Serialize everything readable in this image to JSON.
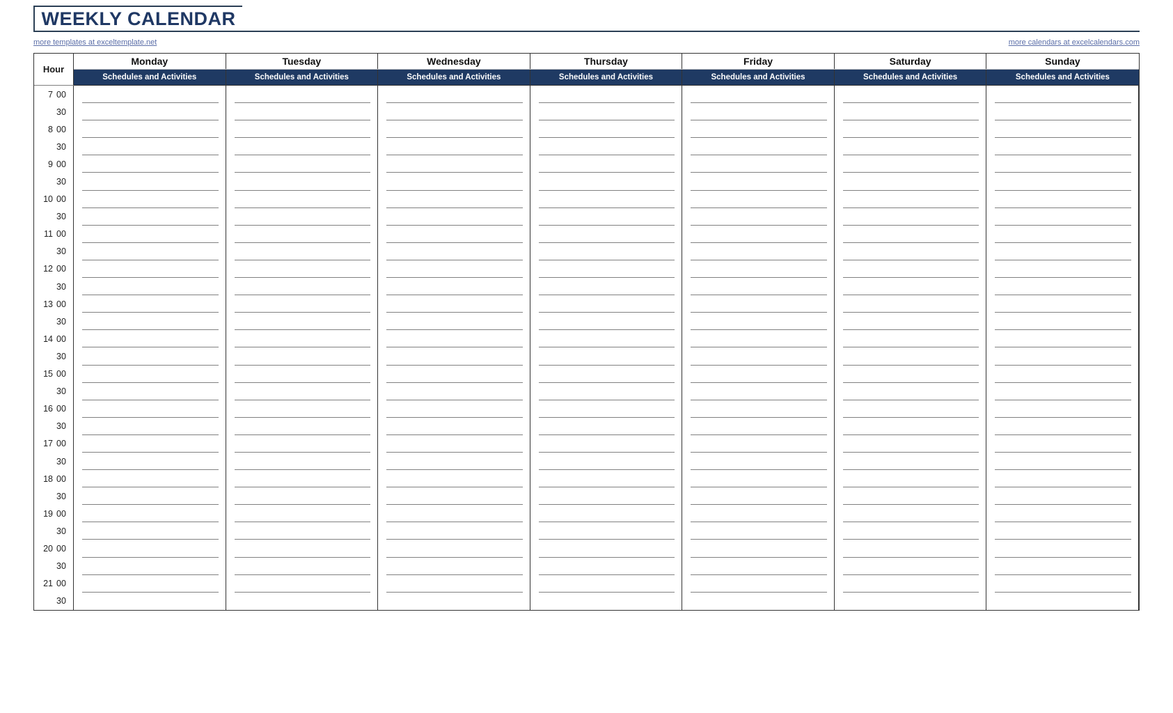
{
  "header": {
    "title": "WEEKLY CALENDAR",
    "left_link": "more templates at exceltemplate.net",
    "right_link": "more calendars at excelcalendars.com"
  },
  "table": {
    "hour_header": "Hour",
    "days": [
      {
        "name": "Monday",
        "sub": "Schedules and Activities"
      },
      {
        "name": "Tuesday",
        "sub": "Schedules and Activities"
      },
      {
        "name": "Wednesday",
        "sub": "Schedules and Activities"
      },
      {
        "name": "Thursday",
        "sub": "Schedules and Activities"
      },
      {
        "name": "Friday",
        "sub": "Schedules and Activities"
      },
      {
        "name": "Saturday",
        "sub": "Schedules and Activities"
      },
      {
        "name": "Sunday",
        "sub": "Schedules and Activities"
      }
    ],
    "rows": [
      {
        "hour": "7",
        "minute": "00"
      },
      {
        "hour": "",
        "minute": "30"
      },
      {
        "hour": "8",
        "minute": "00"
      },
      {
        "hour": "",
        "minute": "30"
      },
      {
        "hour": "9",
        "minute": "00"
      },
      {
        "hour": "",
        "minute": "30"
      },
      {
        "hour": "10",
        "minute": "00"
      },
      {
        "hour": "",
        "minute": "30"
      },
      {
        "hour": "11",
        "minute": "00"
      },
      {
        "hour": "",
        "minute": "30"
      },
      {
        "hour": "12",
        "minute": "00"
      },
      {
        "hour": "",
        "minute": "30"
      },
      {
        "hour": "13",
        "minute": "00"
      },
      {
        "hour": "",
        "minute": "30"
      },
      {
        "hour": "14",
        "minute": "00"
      },
      {
        "hour": "",
        "minute": "30"
      },
      {
        "hour": "15",
        "minute": "00"
      },
      {
        "hour": "",
        "minute": "30"
      },
      {
        "hour": "16",
        "minute": "00"
      },
      {
        "hour": "",
        "minute": "30"
      },
      {
        "hour": "17",
        "minute": "00"
      },
      {
        "hour": "",
        "minute": "30"
      },
      {
        "hour": "18",
        "minute": "00"
      },
      {
        "hour": "",
        "minute": "30"
      },
      {
        "hour": "19",
        "minute": "00"
      },
      {
        "hour": "",
        "minute": "30"
      },
      {
        "hour": "20",
        "minute": "00"
      },
      {
        "hour": "",
        "minute": "30"
      },
      {
        "hour": "21",
        "minute": "00"
      },
      {
        "hour": "",
        "minute": "30"
      }
    ]
  },
  "colors": {
    "navy_band": "#1f3a63",
    "title_blue": "#1f3864",
    "border_dark": "#333333",
    "rule_gray": "#808080",
    "link_violet": "#5b6ea8"
  }
}
